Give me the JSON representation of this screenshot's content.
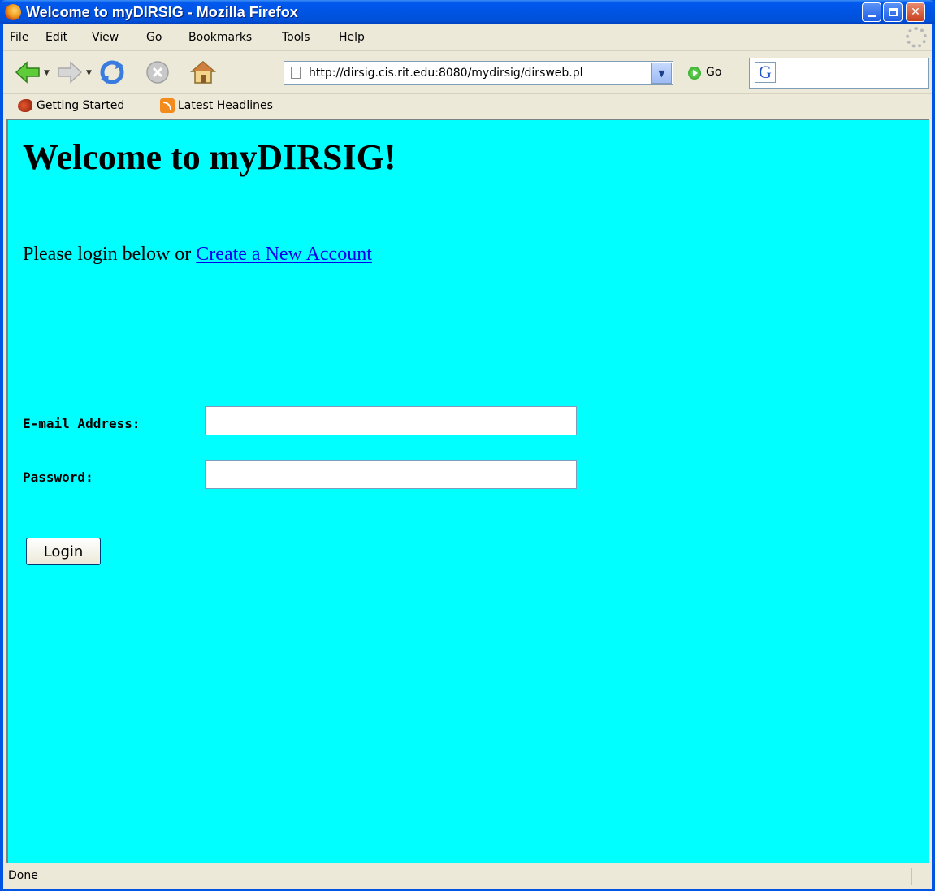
{
  "window": {
    "title": "Welcome to myDIRSIG - Mozilla Firefox"
  },
  "menu": {
    "items": [
      "File",
      "Edit",
      "View",
      "Go",
      "Bookmarks",
      "Tools",
      "Help"
    ]
  },
  "nav": {
    "url": "http://dirsig.cis.rit.edu:8080/mydirsig/dirsweb.pl",
    "go_label": "Go",
    "search_value": "",
    "search_engine_icon": "google-icon"
  },
  "bookmarks": {
    "items": [
      {
        "label": "Getting Started",
        "icon": "firefox-getting-started-icon"
      },
      {
        "label": "Latest Headlines",
        "icon": "rss-feed-icon"
      }
    ]
  },
  "page": {
    "background": "#00ffff",
    "title": "Welcome to myDIRSIG!",
    "intro_text": "Please login below or ",
    "create_account_link": "Create a New Account",
    "email_label": "E-mail Address:",
    "email_value": "",
    "password_label": "Password:",
    "password_value": "",
    "login_button": "Login"
  },
  "status": {
    "text": "Done"
  }
}
